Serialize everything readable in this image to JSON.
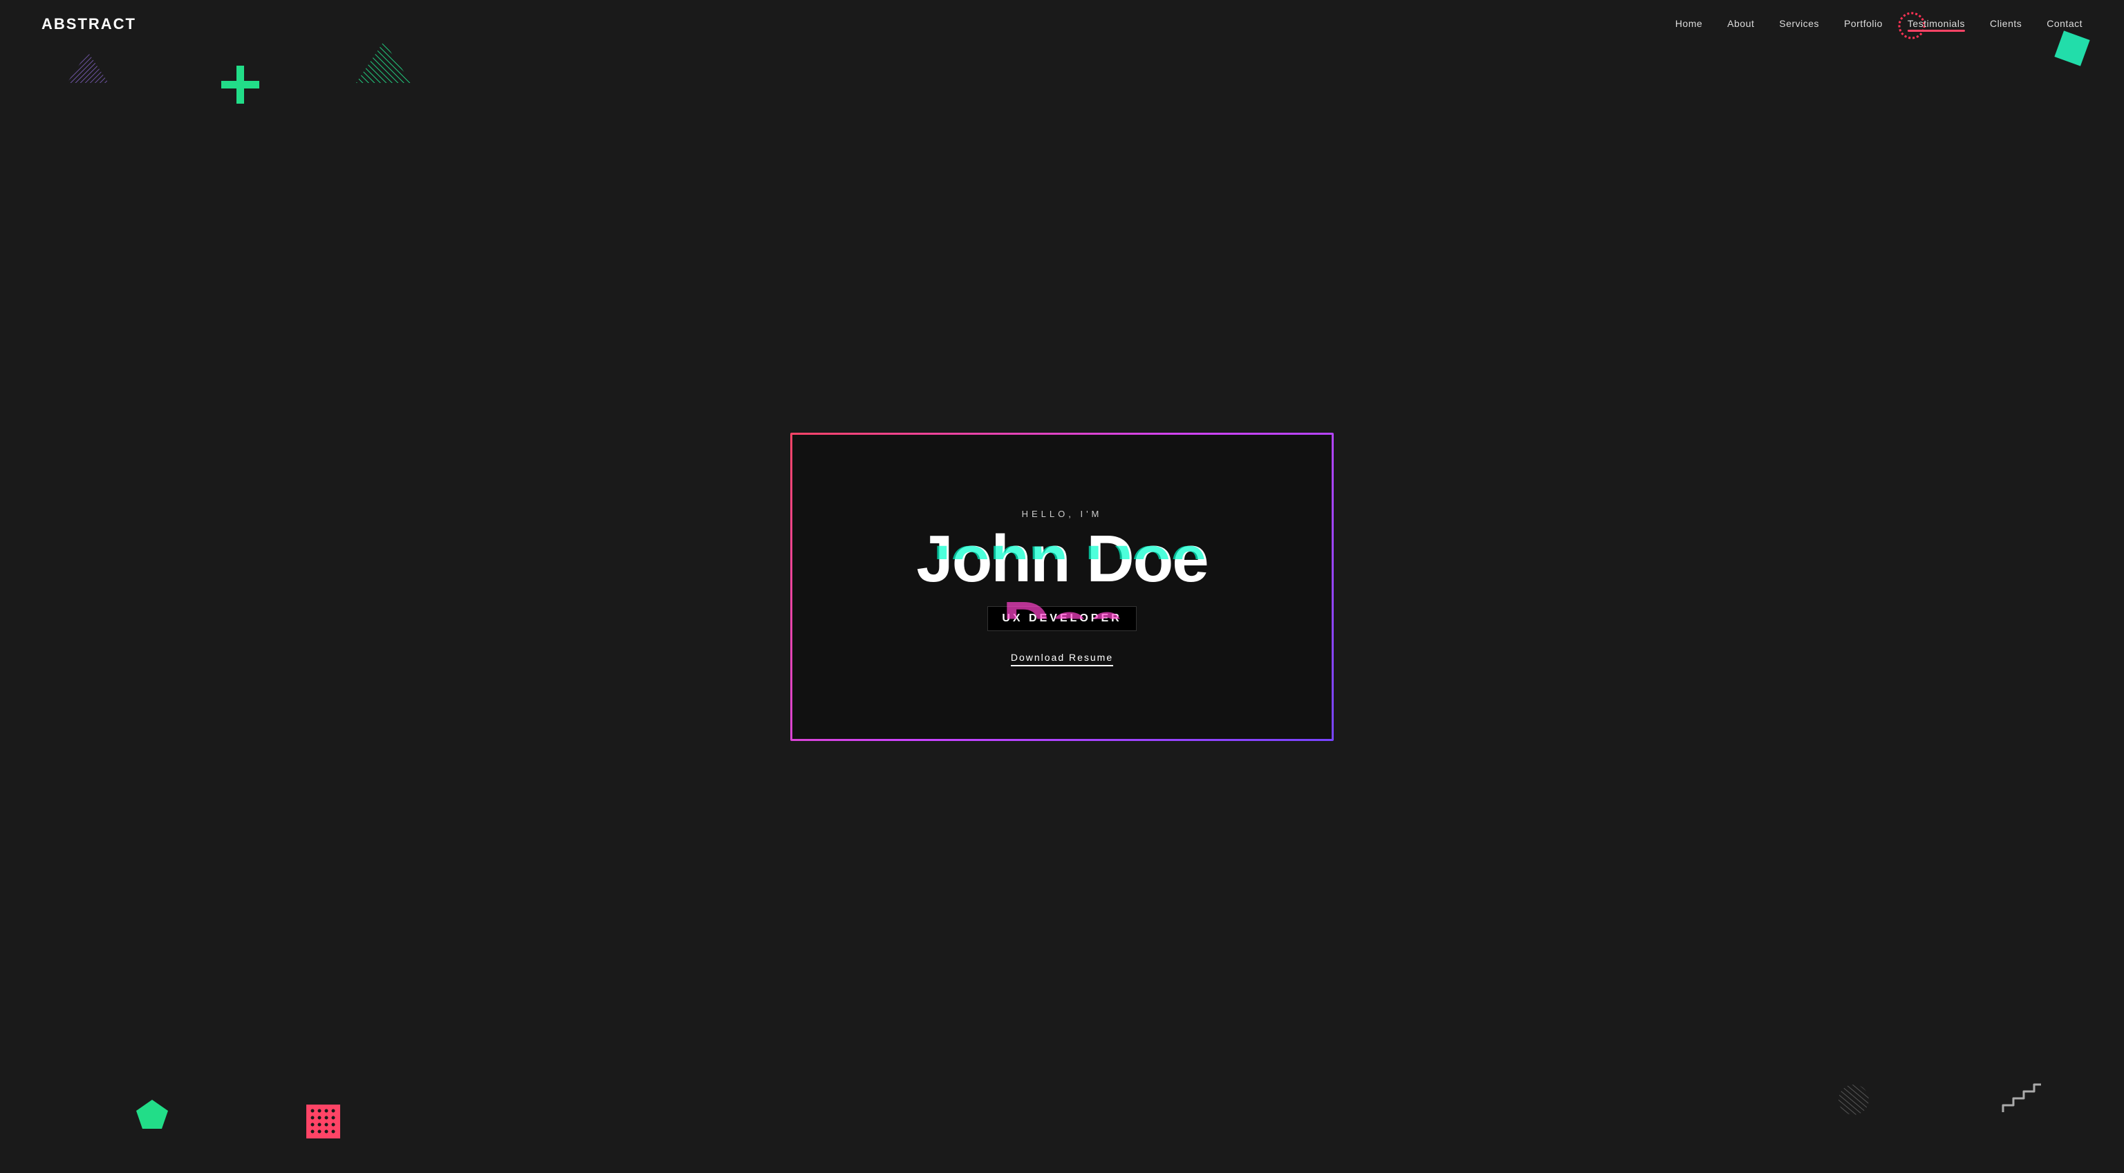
{
  "nav": {
    "logo": "ABSTRACT",
    "links": [
      {
        "label": "Home",
        "id": "home"
      },
      {
        "label": "About",
        "id": "about"
      },
      {
        "label": "Services",
        "id": "services"
      },
      {
        "label": "Portfolio",
        "id": "portfolio"
      },
      {
        "label": "Testimonials",
        "id": "testimonials"
      },
      {
        "label": "Clients",
        "id": "clients"
      },
      {
        "label": "Contact",
        "id": "contact"
      }
    ]
  },
  "hero": {
    "greeting": "HELLO, I'M",
    "name": "John Doe",
    "title": "UX DEVELOPER",
    "download_label": "Download Resume"
  },
  "decorations": {
    "colors": {
      "teal": "#22ddaa",
      "pink": "#ff4466",
      "purple": "#cc44ff"
    }
  }
}
